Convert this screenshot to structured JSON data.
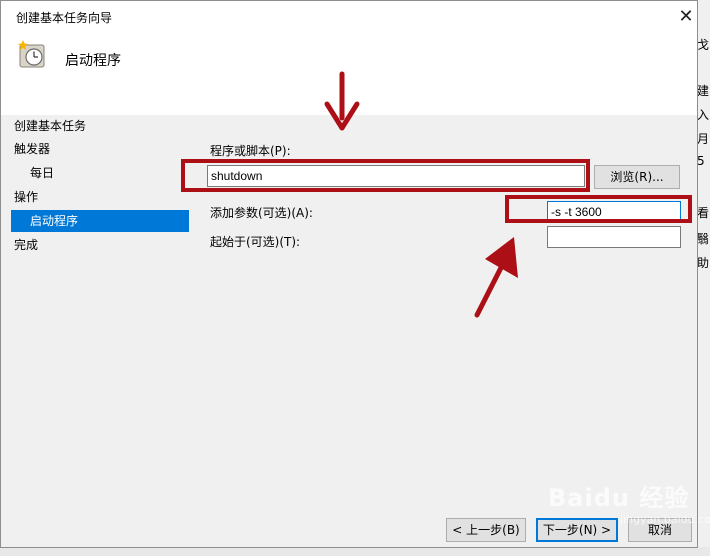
{
  "window": {
    "title": "创建基本任务向导",
    "close_glyph": "✕"
  },
  "header": {
    "title": "启动程序",
    "icon": "task-scheduler-clock-icon"
  },
  "nav": {
    "items": [
      {
        "label": "创建基本任务",
        "selected": false
      },
      {
        "label": "触发器",
        "selected": false
      },
      {
        "label": "每日",
        "selected": false
      },
      {
        "label": "操作",
        "selected": false
      },
      {
        "label": "启动程序",
        "selected": true
      },
      {
        "label": "完成",
        "selected": false
      }
    ]
  },
  "form": {
    "program_label": "程序或脚本(P):",
    "program_value": "shutdown",
    "browse_label": "浏览(R)...",
    "args_label": "添加参数(可选)(A):",
    "args_value": "-s -t 3600",
    "start_in_label": "起始于(可选)(T):",
    "start_in_value": ""
  },
  "footer": {
    "back_label": "< 上一步(B)",
    "next_label": "下一步(N) >",
    "cancel_label": "取消"
  },
  "background_window": {
    "edge_chars": [
      "戈",
      "建",
      "入",
      "月",
      "5",
      "看",
      "翳",
      "助"
    ]
  },
  "watermark": {
    "brand": "Baidu 经验",
    "sub": "jingyan.baidu.com"
  },
  "colors": {
    "annotation": "#ad0f16",
    "selection": "#0078d7",
    "body_bg": "#f0f0f0"
  }
}
